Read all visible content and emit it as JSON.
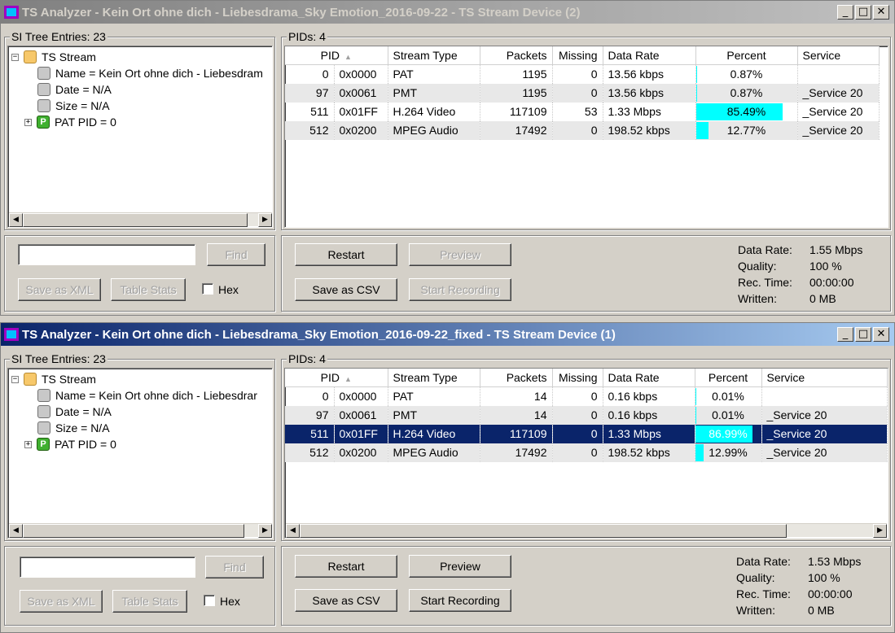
{
  "windows": [
    {
      "title": "TS Analyzer - Kein Ort ohne dich - Liebesdrama_Sky Emotion_2016-09-22 - TS Stream Device (2)",
      "si_tree_label": "SI Tree Entries: 23",
      "tree": {
        "root": "TS Stream",
        "name": "Name = Kein Ort ohne dich - Liebesdram",
        "date": "Date = N/A",
        "size": "Size = N/A",
        "pat": "PAT PID = 0"
      },
      "search_placeholder": "",
      "find_label": "Find",
      "save_xml_label": "Save as XML",
      "table_stats_label": "Table Stats",
      "hex_label": "Hex",
      "pids_label": "PIDs: 4",
      "columns": [
        "PID",
        "Stream Type",
        "Packets",
        "Missing",
        "Data Rate",
        "Percent",
        "Service"
      ],
      "rows": [
        {
          "pid": "0",
          "hex": "0x0000",
          "type": "PAT",
          "packets": "1195",
          "missing": "0",
          "rate": "13.56 kbps",
          "percent": "0.87%",
          "pct_value": 0.87,
          "service": ""
        },
        {
          "pid": "97",
          "hex": "0x0061",
          "type": "PMT",
          "packets": "1195",
          "missing": "0",
          "rate": "13.56 kbps",
          "percent": "0.87%",
          "pct_value": 0.87,
          "service": "_Service 20"
        },
        {
          "pid": "511",
          "hex": "0x01FF",
          "type": "H.264 Video",
          "packets": "117109",
          "missing": "53",
          "rate": "1.33 Mbps",
          "percent": "85.49%",
          "pct_value": 85.49,
          "service": "_Service 20"
        },
        {
          "pid": "512",
          "hex": "0x0200",
          "type": "MPEG Audio",
          "packets": "17492",
          "missing": "0",
          "rate": "198.52 kbps",
          "percent": "12.77%",
          "pct_value": 12.77,
          "service": "_Service 20"
        }
      ],
      "restart_label": "Restart",
      "preview_label": "Preview",
      "save_csv_label": "Save as CSV",
      "start_rec_label": "Start Recording",
      "stats": {
        "data_rate_k": "Data Rate:",
        "data_rate_v": "1.55 Mbps",
        "quality_k": "Quality:",
        "quality_v": "100 %",
        "rec_time_k": "Rec. Time:",
        "rec_time_v": "00:00:00",
        "written_k": "Written:",
        "written_v": "0 MB"
      }
    },
    {
      "title": "TS Analyzer - Kein Ort ohne dich - Liebesdrama_Sky Emotion_2016-09-22_fixed - TS Stream Device (1)",
      "si_tree_label": "SI Tree Entries: 23",
      "tree": {
        "root": "TS Stream",
        "name": "Name = Kein Ort ohne dich - Liebesdrar",
        "date": "Date = N/A",
        "size": "Size = N/A",
        "pat": "PAT PID = 0"
      },
      "search_placeholder": "",
      "find_label": "Find",
      "save_xml_label": "Save as XML",
      "table_stats_label": "Table Stats",
      "hex_label": "Hex",
      "pids_label": "PIDs: 4",
      "columns": [
        "PID",
        "Stream Type",
        "Packets",
        "Missing",
        "Data Rate",
        "Percent",
        "Service"
      ],
      "rows": [
        {
          "pid": "0",
          "hex": "0x0000",
          "type": "PAT",
          "packets": "14",
          "missing": "0",
          "rate": "0.16 kbps",
          "percent": "0.01%",
          "pct_value": 0.01,
          "service": ""
        },
        {
          "pid": "97",
          "hex": "0x0061",
          "type": "PMT",
          "packets": "14",
          "missing": "0",
          "rate": "0.16 kbps",
          "percent": "0.01%",
          "pct_value": 0.01,
          "service": "_Service 20"
        },
        {
          "pid": "511",
          "hex": "0x01FF",
          "type": "H.264 Video",
          "packets": "117109",
          "missing": "0",
          "rate": "1.33 Mbps",
          "percent": "86.99%",
          "pct_value": 86.99,
          "service": "_Service 20"
        },
        {
          "pid": "512",
          "hex": "0x0200",
          "type": "MPEG Audio",
          "packets": "17492",
          "missing": "0",
          "rate": "198.52 kbps",
          "percent": "12.99%",
          "pct_value": 12.99,
          "service": "_Service 20"
        }
      ],
      "restart_label": "Restart",
      "preview_label": "Preview",
      "save_csv_label": "Save as CSV",
      "start_rec_label": "Start Recording",
      "stats": {
        "data_rate_k": "Data Rate:",
        "data_rate_v": "1.53 Mbps",
        "quality_k": "Quality:",
        "quality_v": "100 %",
        "rec_time_k": "Rec. Time:",
        "rec_time_v": "00:00:00",
        "written_k": "Written:",
        "written_v": "0 MB"
      }
    }
  ],
  "colors": {
    "percent_bar": "#00ffff",
    "selection": "#0a246a",
    "active_title": "#0a246a",
    "inactive_title": "#808080"
  },
  "icons": {
    "minimize": "minimize-icon",
    "maximize": "maximize-icon",
    "close": "close-icon"
  }
}
